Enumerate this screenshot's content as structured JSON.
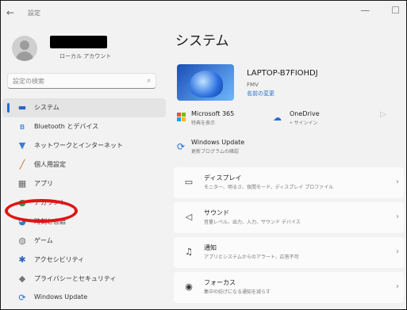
{
  "window": {
    "title": "設定",
    "minimize": "—",
    "maximize": "☐"
  },
  "profile": {
    "account_type": "ローカル アカウント"
  },
  "search": {
    "placeholder": "設定の検索"
  },
  "sidebar": {
    "items": [
      {
        "label": "システム",
        "icon": "monitor-icon",
        "glyph": "▬",
        "color": "#2b63c6",
        "active": true
      },
      {
        "label": "Bluetooth とデバイス",
        "icon": "bluetooth-icon",
        "glyph": "ʙ",
        "color": "#1f6fd1"
      },
      {
        "label": "ネットワークとインターネット",
        "icon": "wifi-icon",
        "glyph": "▼",
        "color": "#3a7bd5"
      },
      {
        "label": "個人用設定",
        "icon": "brush-icon",
        "glyph": "╱",
        "color": "#c46b2a"
      },
      {
        "label": "アプリ",
        "icon": "apps-icon",
        "glyph": "▦",
        "color": "#666666"
      },
      {
        "label": "アカウント",
        "icon": "account-icon",
        "glyph": "●",
        "color": "#2a9b5b"
      },
      {
        "label": "時刻と言語",
        "icon": "globe-clock-icon",
        "glyph": "◕",
        "color": "#2f7fd0"
      },
      {
        "label": "ゲーム",
        "icon": "gamepad-icon",
        "glyph": "◍",
        "color": "#777777"
      },
      {
        "label": "アクセシビリティ",
        "icon": "accessibility-icon",
        "glyph": "✱",
        "color": "#2b63c6"
      },
      {
        "label": "プライバシーとセキュリティ",
        "icon": "shield-icon",
        "glyph": "◆",
        "color": "#777777"
      },
      {
        "label": "Windows Update",
        "icon": "windows-update-icon",
        "glyph": "⟳",
        "color": "#1f6fd1"
      }
    ]
  },
  "main": {
    "title": "システム",
    "device": {
      "name": "LAPTOP-B7FIOHDJ",
      "model": "FMV",
      "rename": "名前の変更"
    },
    "tiles": {
      "microsoft365": {
        "title": "Microsoft 365",
        "sub": "特典を表示"
      },
      "onedrive": {
        "title": "OneDrive",
        "sub": "• サインイン"
      },
      "windows_update": {
        "title": "Windows Update",
        "sub": "更新プログラムの確認"
      }
    },
    "cards": [
      {
        "title": "ディスプレイ",
        "sub": "モニター、明るさ、夜間モード、ディスプレイ プロファイル",
        "icon": "display-icon",
        "glyph": "▭"
      },
      {
        "title": "サウンド",
        "sub": "音量レベル、出力、入力、サウンド デバイス",
        "icon": "speaker-icon",
        "glyph": "◁"
      },
      {
        "title": "通知",
        "sub": "アプリとシステムからのアラート、応答不可",
        "icon": "bell-icon",
        "glyph": "♫"
      },
      {
        "title": "フォーカス",
        "sub": "集中の妨げになる通知を減らす",
        "icon": "focus-icon",
        "glyph": "◉"
      }
    ],
    "chevron": "›"
  },
  "colors": {
    "accent": "#1f6fd1",
    "highlight": "#e11414"
  }
}
